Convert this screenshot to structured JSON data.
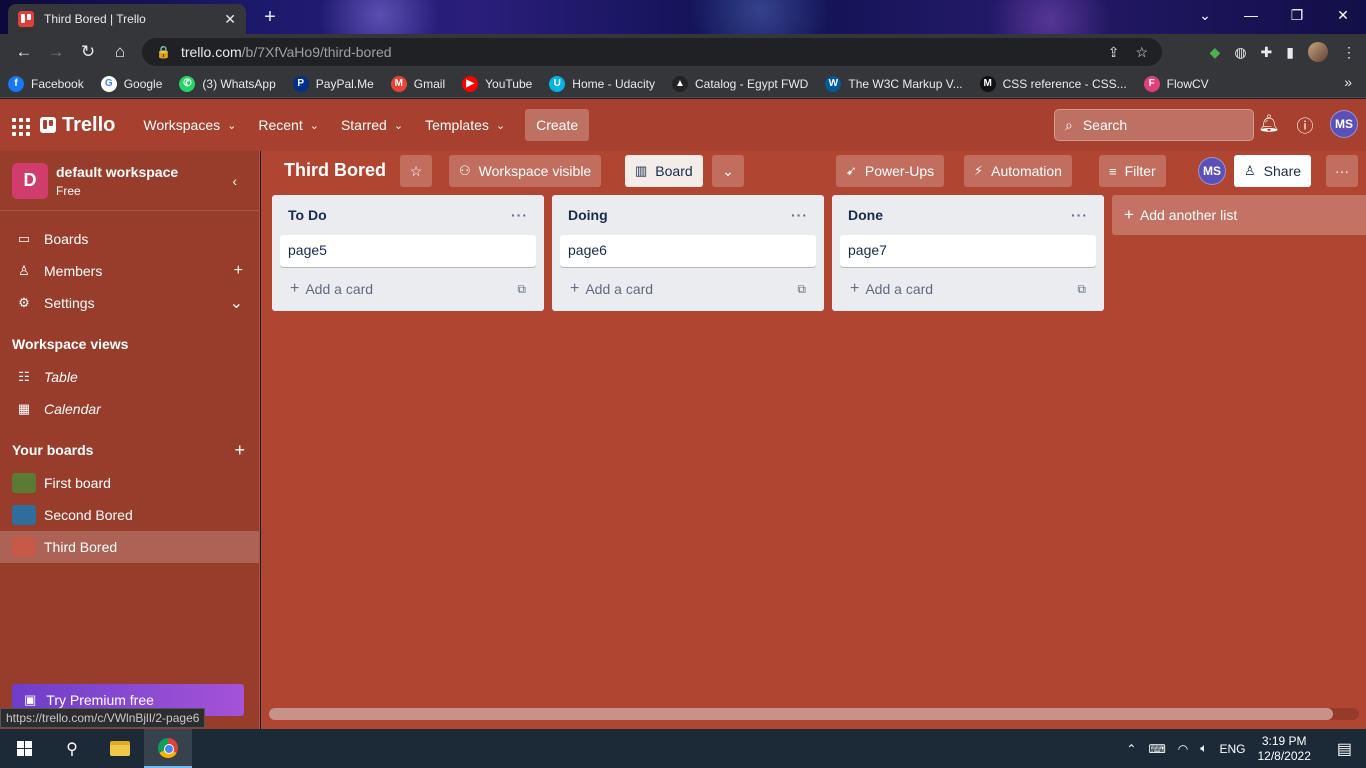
{
  "browser": {
    "tab_title": "Third Bored | Trello",
    "url_host": "trello.com",
    "url_path": "/b/7XfVaHo9/third-bored",
    "bookmarks": [
      {
        "label": "Facebook",
        "icon": "facebook-icon",
        "color": "#1877f2",
        "glyph": "f"
      },
      {
        "label": "Google",
        "icon": "google-icon",
        "color": "#ffffff",
        "glyph": "G"
      },
      {
        "label": "(3) WhatsApp",
        "icon": "whatsapp-icon",
        "color": "#25d366",
        "glyph": "✆"
      },
      {
        "label": "PayPal.Me",
        "icon": "paypal-icon",
        "color": "#003087",
        "glyph": "P"
      },
      {
        "label": "Gmail",
        "icon": "gmail-icon",
        "color": "#ea4335",
        "glyph": "M"
      },
      {
        "label": "YouTube",
        "icon": "youtube-icon",
        "color": "#ff0000",
        "glyph": "▶"
      },
      {
        "label": "Home - Udacity",
        "icon": "udacity-icon",
        "color": "#02b3e4",
        "glyph": "U"
      },
      {
        "label": "Catalog - Egypt FWD",
        "icon": "fwd-icon",
        "color": "#222222",
        "glyph": "▲"
      },
      {
        "label": "The W3C Markup V...",
        "icon": "w3c-icon",
        "color": "#005a9c",
        "glyph": "W"
      },
      {
        "label": "CSS reference - CSS...",
        "icon": "mdn-icon",
        "color": "#111111",
        "glyph": "M"
      },
      {
        "label": "FlowCV",
        "icon": "flowcv-icon",
        "color": "#e0407a",
        "glyph": "F"
      }
    ],
    "status_url": "https://trello.com/c/VWlnBjlI/2-page6"
  },
  "header": {
    "logo": "Trello",
    "nav": [
      "Workspaces",
      "Recent",
      "Starred",
      "Templates"
    ],
    "create_label": "Create",
    "search_placeholder": "Search",
    "avatar_initials": "MS"
  },
  "sidebar": {
    "workspace_initial": "D",
    "workspace_name": "default workspace",
    "workspace_plan": "Free",
    "items": [
      "Boards",
      "Members",
      "Settings"
    ],
    "views_heading": "Workspace views",
    "views": [
      "Table",
      "Calendar"
    ],
    "boards_heading": "Your boards",
    "boards": [
      {
        "name": "First board",
        "color": "#5b7b34"
      },
      {
        "name": "Second Bored",
        "color": "#2f6d9b"
      },
      {
        "name": "Third Bored",
        "color": "#b04632"
      }
    ],
    "premium_label": "Try Premium free"
  },
  "board": {
    "title": "Third Bored",
    "visibility_label": "Workspace visible",
    "view_label": "Board",
    "powerups_label": "Power-Ups",
    "automation_label": "Automation",
    "filter_label": "Filter",
    "member_initials": "MS",
    "share_label": "Share",
    "add_card_label": "Add a card",
    "add_list_label": "Add another list",
    "lists": [
      {
        "title": "To Do",
        "cards": [
          "page5"
        ]
      },
      {
        "title": "Doing",
        "cards": [
          "page6"
        ]
      },
      {
        "title": "Done",
        "cards": [
          "page7"
        ]
      }
    ]
  },
  "taskbar": {
    "language": "ENG",
    "time": "3:19 PM",
    "date": "12/8/2022"
  }
}
